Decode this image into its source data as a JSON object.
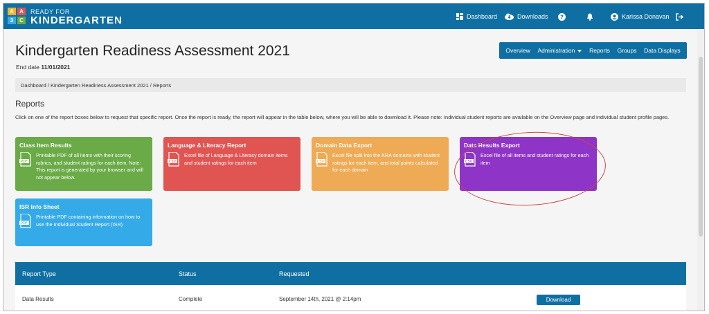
{
  "header": {
    "logo_top": "READY FOR",
    "logo_main": "KINDERGARTEN",
    "logo_letters": [
      "A",
      "A",
      "3",
      "C"
    ],
    "nav": {
      "dashboard": "Dashboard",
      "downloads": "Downloads",
      "user": "Karissa Donavan"
    }
  },
  "page": {
    "title": "Kindergarten Readiness Assessment 2021",
    "end_date_label": "End date",
    "end_date_value": "11/01/2021"
  },
  "tabs": [
    "Overview",
    "Administration",
    "Reports",
    "Groups",
    "Data Displays"
  ],
  "breadcrumb": "Dashboard  /  Kindergarten Readiness Assessment 2021  /  Reports",
  "reports": {
    "heading": "Reports",
    "intro": "Click on one of the report boxes below to request that specific report. Once the report is ready, the report will appear in the table below, where you will be able to download it. Please note: Individual student reports are available on the Overview page and individual student profile pages.",
    "cards": [
      {
        "title": "Class Item Results",
        "desc": "Printable PDF of all items with their scoring rubrics, and student ratings for each item. Note: This report is generated by your browser and will not appear below.",
        "doc": "PDF",
        "color": "#6aaa47"
      },
      {
        "title": "Language & Literacy Report",
        "desc": "Excel file of Language & Literacy domain items and student ratings for each item",
        "doc": "CSV",
        "color": "#e05552"
      },
      {
        "title": "Domain Data Export",
        "desc": "Excel file split into the KRA domains with student ratings for each item, and total points calculated for each domain",
        "doc": "CSV",
        "color": "#eeaa55"
      },
      {
        "title": "Data Results Export",
        "desc": "Excel file of all items and student ratings for each item",
        "doc": "CSV",
        "color": "#8e34c6"
      },
      {
        "title": "ISR Info Sheet",
        "desc": "Printable PDF containing information on how to use the Individual Student Report (ISR)",
        "doc": "PDF",
        "color": "#35aae8"
      }
    ]
  },
  "table": {
    "headers": [
      "Report Type",
      "Status",
      "Requested"
    ],
    "rows": [
      {
        "type": "Data Results",
        "status": "Complete",
        "requested": "September 14th, 2021 @ 2:14pm",
        "action": "Download"
      }
    ]
  },
  "colors": {
    "brand": "#0f6fa3",
    "highlight_circle": "#c94646"
  }
}
